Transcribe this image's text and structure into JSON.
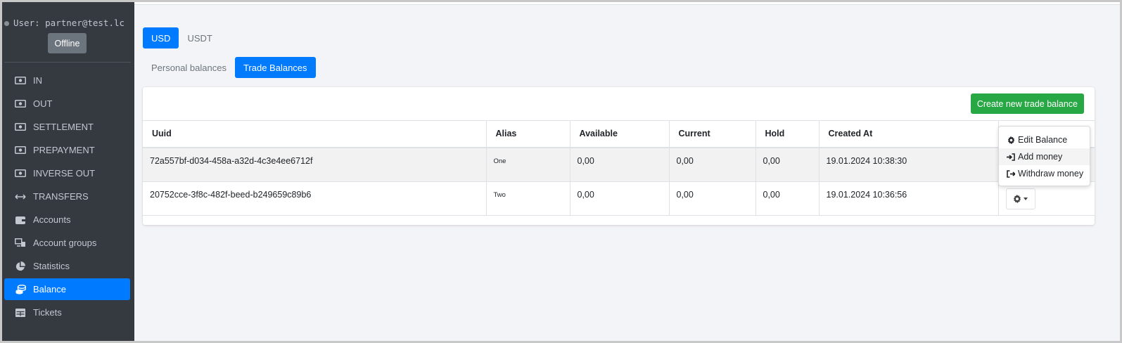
{
  "sidebar": {
    "user_text": "User: partner@test.lc",
    "status_button": "Offline",
    "items": [
      {
        "label": "IN",
        "icon": "money-bill-icon"
      },
      {
        "label": "OUT",
        "icon": "money-bill-icon"
      },
      {
        "label": "SETTLEMENT",
        "icon": "money-bill-icon"
      },
      {
        "label": "PREPAYMENT",
        "icon": "money-bill-icon"
      },
      {
        "label": "INVERSE OUT",
        "icon": "money-bill-icon"
      },
      {
        "label": "TRANSFERS",
        "icon": "arrows-h-icon"
      },
      {
        "label": "Accounts",
        "icon": "wallet-icon"
      },
      {
        "label": "Account groups",
        "icon": "network-icon"
      },
      {
        "label": "Statistics",
        "icon": "pie-chart-icon"
      },
      {
        "label": "Balance",
        "icon": "coins-icon",
        "active": true
      },
      {
        "label": "Tickets",
        "icon": "table-icon"
      }
    ]
  },
  "currency_tabs": [
    {
      "label": "USD",
      "active": true
    },
    {
      "label": "USDT",
      "active": false
    }
  ],
  "balance_tabs": [
    {
      "label": "Personal balances",
      "active": false
    },
    {
      "label": "Trade Balances",
      "active": true
    }
  ],
  "card": {
    "create_button": "Create new trade balance",
    "columns": [
      "Uuid",
      "Alias",
      "Available",
      "Current",
      "Hold",
      "Created At",
      ""
    ],
    "rows": [
      {
        "uuid": "72a557bf-d034-458a-a32d-4c3e4ee6712f",
        "alias": "One",
        "available": "0,00",
        "current": "0,00",
        "hold": "0,00",
        "created_at": "19.01.2024 10:38:30"
      },
      {
        "uuid": "20752cce-3f8c-482f-beed-b249659c89b6",
        "alias": "Two",
        "available": "0,00",
        "current": "0,00",
        "hold": "0,00",
        "created_at": "19.01.2024 10:36:56"
      }
    ]
  },
  "dropdown": {
    "items": [
      {
        "label": "Edit Balance",
        "icon": "cog-icon"
      },
      {
        "label": "Add money",
        "icon": "sign-in-icon"
      },
      {
        "label": "Withdraw money",
        "icon": "sign-out-icon"
      }
    ]
  },
  "colors": {
    "sidebar_bg": "#343a40",
    "primary": "#007bff",
    "success": "#28a745",
    "secondary": "#6c757d"
  }
}
